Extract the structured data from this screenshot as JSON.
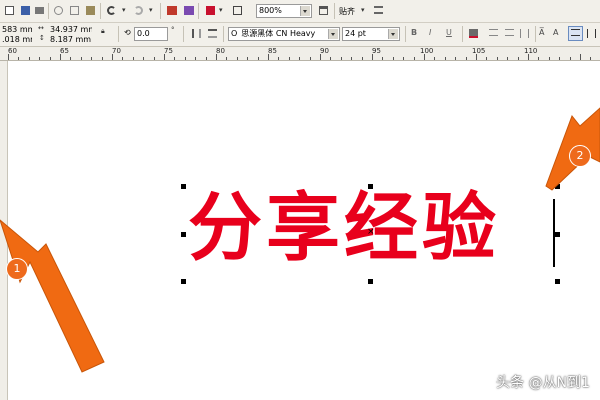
{
  "toolbar_top": {
    "zoom_value": "800%",
    "snap_label": "贴齐"
  },
  "property_bar": {
    "x_value": "583 mm",
    "y_value": ".018 mm",
    "width_value": "34.937 mm",
    "height_value": "8.187 mm",
    "rotation_value": "0.0",
    "rotation_unit": "°",
    "font_name": "思源黑体 CN Heavy",
    "font_prefix": "O",
    "font_size": "24 pt"
  },
  "ruler": {
    "labels": [
      "60",
      "65",
      "70",
      "75",
      "80",
      "85",
      "90",
      "95",
      "100",
      "105",
      "110"
    ]
  },
  "canvas": {
    "text": "分享经验",
    "text_color": "#e8001c"
  },
  "annotations": {
    "badge_1": "1",
    "badge_2": "2",
    "arrow_color": "#f06a12"
  },
  "watermark": {
    "text": "头条 @从N到1"
  }
}
